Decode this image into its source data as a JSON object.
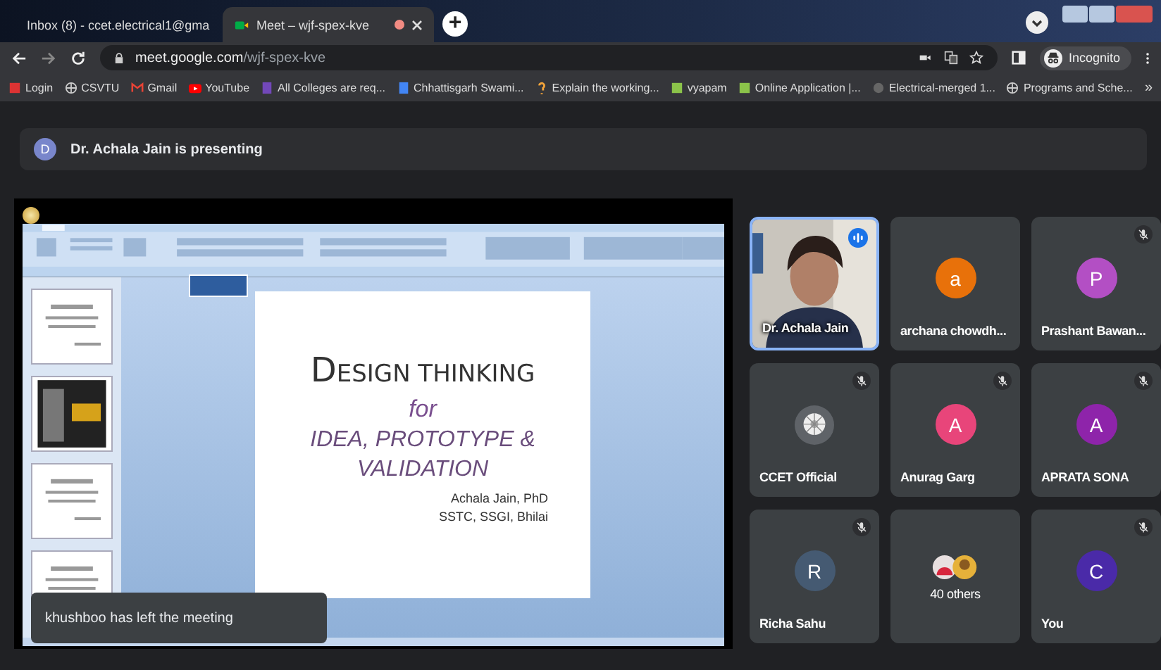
{
  "browser": {
    "tabs": [
      {
        "title": "Inbox (8) - ccet.electrical1@gma",
        "kind": "mail",
        "selected": false
      },
      {
        "title": "Meet – wjf-spex-kve",
        "kind": "meet",
        "selected": true,
        "recording": true
      }
    ],
    "new_tab": "+",
    "url": {
      "host": "meet.google.com",
      "path": "/wjf-spex-kve"
    },
    "profile": "Incognito",
    "bookmarks": [
      {
        "label": "Login",
        "kind": "red"
      },
      {
        "label": "CSVTU",
        "kind": "globe"
      },
      {
        "label": "Gmail",
        "kind": "mail"
      },
      {
        "label": "YouTube",
        "kind": "play"
      },
      {
        "label": "All Colleges are req...",
        "kind": "form"
      },
      {
        "label": "Chhattisgarh Swami...",
        "kind": "doc"
      },
      {
        "label": "Explain the working...",
        "kind": "question"
      },
      {
        "label": "vyapam",
        "kind": "sheet"
      },
      {
        "label": "Online Application |...",
        "kind": "sheet"
      },
      {
        "label": "Electrical-merged 1...",
        "kind": "circle"
      },
      {
        "label": "Programs and Sche...",
        "kind": "globe"
      }
    ],
    "more": "»"
  },
  "meet": {
    "presenting": {
      "initial": "D",
      "text": "Dr. Achala Jain is presenting"
    },
    "slide": {
      "title": "DESIGN THINKING",
      "subtitle": "for",
      "line_1": "IDEA, PROTOTYPE &",
      "line_2": "VALIDATION",
      "author": "Achala Jain, PhD",
      "affiliation": "SSTC, SSGI, Bhilai"
    },
    "participants": [
      {
        "name": "Dr. Achala Jain",
        "kind": "video",
        "muted": false,
        "speaking": true
      },
      {
        "name": "archana chowdh...",
        "kind": "avatar",
        "letter": "a",
        "color": "#e8710a",
        "muted": false,
        "speaking": false
      },
      {
        "name": "Prashant Bawan...",
        "kind": "avatar",
        "letter": "P",
        "color": "#b34fc4",
        "muted": true,
        "speaking": false
      },
      {
        "name": "CCET Official",
        "kind": "logo",
        "muted": true,
        "speaking": false
      },
      {
        "name": "Anurag Garg",
        "kind": "avatar",
        "letter": "A",
        "color": "#e8457a",
        "muted": true,
        "speaking": false
      },
      {
        "name": "APRATA SONA",
        "kind": "avatar",
        "letter": "A",
        "color": "#8e24aa",
        "muted": true,
        "speaking": false
      },
      {
        "name": "Richa Sahu",
        "kind": "avatar",
        "letter": "R",
        "color": "#455a72",
        "muted": true,
        "speaking": false
      },
      {
        "name": "40 others",
        "kind": "group",
        "muted": false,
        "speaking": false
      },
      {
        "name": "You",
        "kind": "avatar",
        "letter": "C",
        "color": "#4a2aa8",
        "muted": true,
        "speaking": false
      }
    ],
    "toast": "khushboo has left the meeting"
  }
}
